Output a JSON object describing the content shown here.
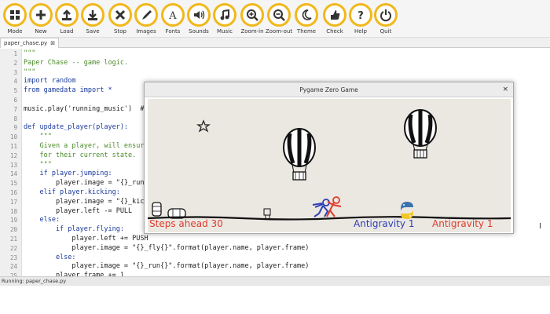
{
  "toolbar": {
    "accent_color": "#f1b81b",
    "buttons": [
      {
        "label": "Mode",
        "icon": "mode-icon"
      },
      {
        "label": "New",
        "icon": "new-icon"
      },
      {
        "label": "Load",
        "icon": "load-icon"
      },
      {
        "label": "Save",
        "icon": "save-icon"
      },
      {
        "label": "Stop",
        "icon": "stop-icon"
      },
      {
        "label": "Images",
        "icon": "images-icon"
      },
      {
        "label": "Fonts",
        "icon": "fonts-icon"
      },
      {
        "label": "Sounds",
        "icon": "sounds-icon"
      },
      {
        "label": "Music",
        "icon": "music-icon"
      },
      {
        "label": "Zoom-in",
        "icon": "zoom-in-icon"
      },
      {
        "label": "Zoom-out",
        "icon": "zoom-out-icon"
      },
      {
        "label": "Theme",
        "icon": "theme-icon"
      },
      {
        "label": "Check",
        "icon": "check-icon"
      },
      {
        "label": "Help",
        "icon": "help-icon"
      },
      {
        "label": "Quit",
        "icon": "quit-icon"
      }
    ]
  },
  "tab": {
    "filename": "paper_chase.py",
    "close": "⊠"
  },
  "editor": {
    "lines": [
      {
        "n": "1",
        "text": "\"\"\"",
        "cls": "c-str"
      },
      {
        "n": "2",
        "text": "Paper Chase -- game logic.",
        "cls": "c-str"
      },
      {
        "n": "3",
        "text": "\"\"\"",
        "cls": "c-str"
      },
      {
        "n": "4",
        "text": "import random",
        "cls": "c-kw"
      },
      {
        "n": "5",
        "text": "from gamedata import *",
        "cls": "c-kw"
      },
      {
        "n": "6",
        "text": "",
        "cls": "c-plain"
      },
      {
        "n": "7",
        "text": "music.play('running_music')  #",
        "cls": "c-plain"
      },
      {
        "n": "8",
        "text": "",
        "cls": "c-plain"
      },
      {
        "n": "9",
        "text": "def update_player(player):",
        "cls": "c-fn"
      },
      {
        "n": "10",
        "text": "    \"\"\"",
        "cls": "c-str"
      },
      {
        "n": "11",
        "text": "    Given a player, will ensur",
        "cls": "c-str"
      },
      {
        "n": "12",
        "text": "    for their current state.",
        "cls": "c-str"
      },
      {
        "n": "13",
        "text": "    \"\"\"",
        "cls": "c-str"
      },
      {
        "n": "14",
        "text": "    if player.jumping:",
        "cls": "c-kw"
      },
      {
        "n": "15",
        "text": "        player.image = \"{}_run",
        "cls": "c-plain"
      },
      {
        "n": "16",
        "text": "    elif player.kicking:",
        "cls": "c-kw"
      },
      {
        "n": "17",
        "text": "        player.image = \"{}_kic",
        "cls": "c-plain"
      },
      {
        "n": "18",
        "text": "        player.left -= PULL",
        "cls": "c-plain"
      },
      {
        "n": "19",
        "text": "    else:",
        "cls": "c-kw"
      },
      {
        "n": "20",
        "text": "        if player.flying:",
        "cls": "c-kw"
      },
      {
        "n": "21",
        "text": "            player.left += PUSH",
        "cls": "c-plain"
      },
      {
        "n": "22",
        "text": "            player.image = \"{}_fly{}\".format(player.name, player.frame)",
        "cls": "c-plain"
      },
      {
        "n": "23",
        "text": "        else:",
        "cls": "c-kw"
      },
      {
        "n": "24",
        "text": "            player.image = \"{}_run{}\".format(player.name, player.frame)",
        "cls": "c-plain"
      },
      {
        "n": "25",
        "text": "        player.frame += 1",
        "cls": "c-plain"
      }
    ]
  },
  "status": {
    "text": "Running: paper_chase.py"
  },
  "game": {
    "title": "Pygame Zero Game",
    "close": "×",
    "hud": [
      {
        "text": "Steps ahead 30",
        "color": "#e03a2a"
      },
      {
        "text": "Antigravity 1",
        "color": "#2e3fb5"
      },
      {
        "text": "Antigravity 1",
        "color": "#e03a2a"
      }
    ]
  }
}
